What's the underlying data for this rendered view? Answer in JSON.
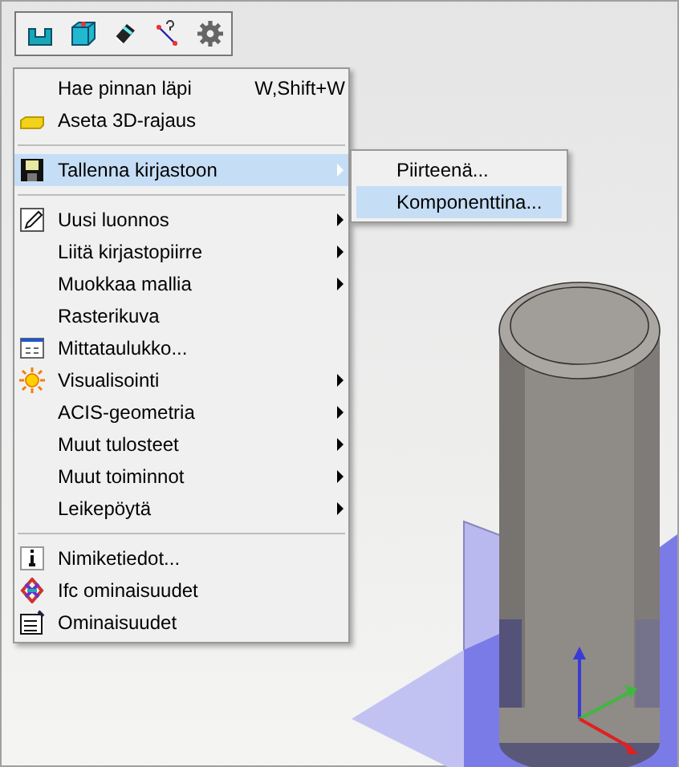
{
  "menu": {
    "items": [
      {
        "kind": "item",
        "label": "Hae pinnan läpi",
        "shortcut": "W,Shift+W",
        "submenu": false,
        "selected": false
      },
      {
        "kind": "item",
        "label": "Aseta 3D-rajaus",
        "submenu": false,
        "selected": false
      },
      {
        "kind": "separator"
      },
      {
        "kind": "item",
        "label": "Tallenna kirjastoon",
        "submenu": true,
        "selected": true
      },
      {
        "kind": "separator"
      },
      {
        "kind": "item",
        "label": "Uusi luonnos",
        "submenu": true,
        "selected": false
      },
      {
        "kind": "item",
        "label": "Liitä kirjastopiirre",
        "submenu": true,
        "selected": false
      },
      {
        "kind": "item",
        "label": "Muokkaa mallia",
        "submenu": true,
        "selected": false
      },
      {
        "kind": "item",
        "label": "Rasterikuva",
        "submenu": false,
        "selected": false
      },
      {
        "kind": "item",
        "label": "Mittataulukko...",
        "submenu": false,
        "selected": false
      },
      {
        "kind": "item",
        "label": "Visualisointi",
        "submenu": true,
        "selected": false
      },
      {
        "kind": "item",
        "label": "ACIS-geometria",
        "submenu": true,
        "selected": false
      },
      {
        "kind": "item",
        "label": "Muut tulosteet",
        "submenu": true,
        "selected": false
      },
      {
        "kind": "item",
        "label": "Muut toiminnot",
        "submenu": true,
        "selected": false
      },
      {
        "kind": "item",
        "label": "Leikepöytä",
        "submenu": true,
        "selected": false
      },
      {
        "kind": "separator"
      },
      {
        "kind": "item",
        "label": "Nimiketiedot...",
        "submenu": false,
        "selected": false
      },
      {
        "kind": "item",
        "label": "Ifc ominaisuudet",
        "submenu": false,
        "selected": false
      },
      {
        "kind": "item",
        "label": "Ominaisuudet",
        "submenu": false,
        "selected": false
      }
    ]
  },
  "submenu": {
    "items": [
      {
        "label": "Piirteenä...",
        "selected": false
      },
      {
        "label": "Komponenttina...",
        "selected": true
      }
    ]
  }
}
